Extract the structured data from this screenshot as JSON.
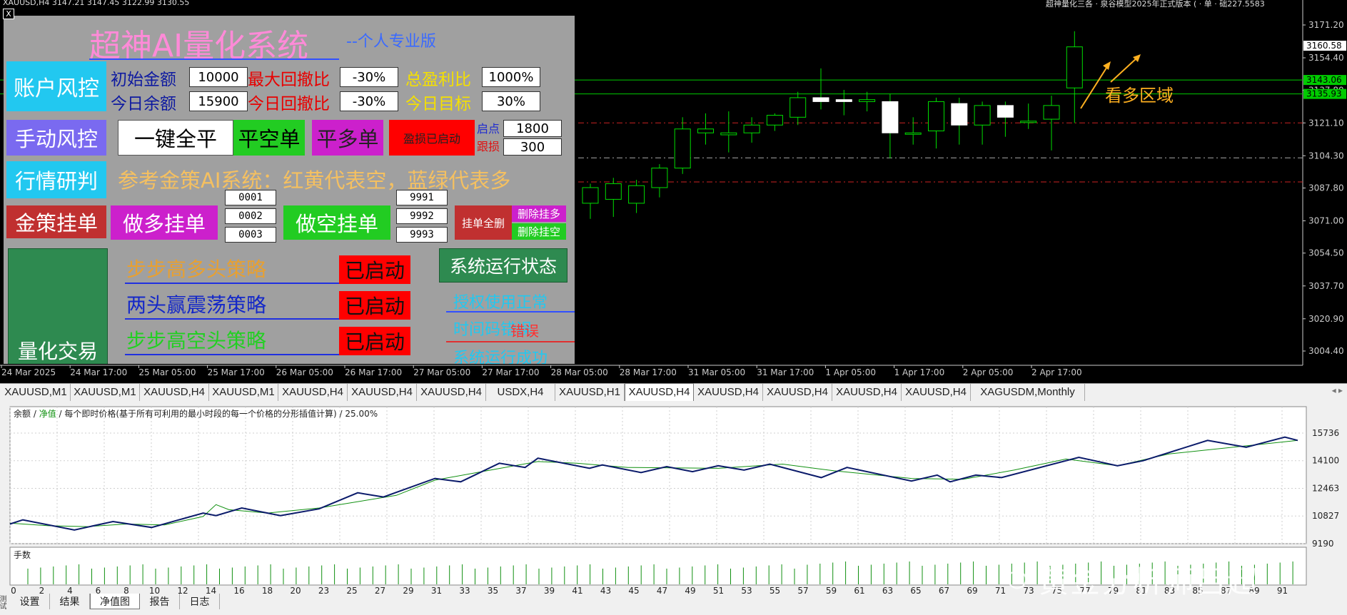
{
  "colors": {
    "bull": "#ffffff",
    "wick": "#00dd00",
    "axis": "#cccccc",
    "hline_green": "#00cc00",
    "hline_red": "#cc2222",
    "price_badge_green": "#00cc00",
    "price_badge_white": "#ffffff",
    "annot_orange": "#ffb020",
    "equity_blue": "#0a1a6a",
    "balance_green": "#109010"
  },
  "chart": {
    "header_left": "XAUUSD,H4  3147.21 3147.45 3122.99 3130.55",
    "header_right": "超神量化三各 · 泉谷模型2025年正式版本 ( · 单 · 础227.5583",
    "y_ticks": [
      "3171.20",
      "3154.40",
      "3137.80",
      "3121.10",
      "3104.30",
      "3087.80",
      "3071.00",
      "3054.50",
      "3037.70",
      "3020.90",
      "3004.40"
    ],
    "price_badges": [
      {
        "label": "3160.58",
        "price": 3160.58,
        "style": "white"
      },
      {
        "label": "3143.06",
        "price": 3143.06,
        "style": "green"
      },
      {
        "label": "3135.93",
        "price": 3135.93,
        "style": "green"
      }
    ],
    "x_ticks": [
      "24 Mar 2025",
      "24 Mar 17:00",
      "25 Mar 05:00",
      "25 Mar 17:00",
      "26 Mar 05:00",
      "26 Mar 17:00",
      "27 Mar 05:00",
      "27 Mar 17:00",
      "28 Mar 05:00",
      "28 Mar 17:00",
      "31 Mar 05:00",
      "31 Mar 17:00",
      "1 Apr 05:00",
      "1 Apr 17:00",
      "2 Apr 05:00",
      "2 Apr 17:00"
    ],
    "annotation": "看多区域",
    "candles": [
      {
        "o": 3080,
        "h": 3090,
        "l": 3072,
        "c": 3088
      },
      {
        "o": 3082,
        "h": 3093,
        "l": 3073,
        "c": 3090
      },
      {
        "o": 3080,
        "h": 3092,
        "l": 3075,
        "c": 3089
      },
      {
        "o": 3088,
        "h": 3100,
        "l": 3083,
        "c": 3098
      },
      {
        "o": 3098,
        "h": 3124,
        "l": 3095,
        "c": 3118
      },
      {
        "o": 3116,
        "h": 3126,
        "l": 3110,
        "c": 3118
      },
      {
        "o": 3115,
        "h": 3127,
        "l": 3106,
        "c": 3116
      },
      {
        "o": 3116,
        "h": 3124,
        "l": 3111,
        "c": 3120
      },
      {
        "o": 3120,
        "h": 3126,
        "l": 3117,
        "c": 3125
      },
      {
        "o": 3124,
        "h": 3137,
        "l": 3120,
        "c": 3134
      },
      {
        "o": 3134,
        "h": 3149,
        "l": 3128,
        "c": 3132
      },
      {
        "o": 3133,
        "h": 3138,
        "l": 3125,
        "c": 3132
      },
      {
        "o": 3132,
        "h": 3137,
        "l": 3127,
        "c": 3133
      },
      {
        "o": 3132,
        "h": 3136,
        "l": 3103,
        "c": 3116
      },
      {
        "o": 3116,
        "h": 3124,
        "l": 3110,
        "c": 3116
      },
      {
        "o": 3117,
        "h": 3134,
        "l": 3108,
        "c": 3132
      },
      {
        "o": 3131,
        "h": 3134,
        "l": 3110,
        "c": 3120
      },
      {
        "o": 3120,
        "h": 3132,
        "l": 3110,
        "c": 3130
      },
      {
        "o": 3130,
        "h": 3132,
        "l": 3114,
        "c": 3124
      },
      {
        "o": 3122,
        "h": 3131,
        "l": 3118,
        "c": 3122
      },
      {
        "o": 3123,
        "h": 3135,
        "l": 3107,
        "c": 3130
      },
      {
        "o": 3139,
        "h": 3168,
        "l": 3121,
        "c": 3160
      }
    ]
  },
  "panel": {
    "title": "超神AI量化系统",
    "subtitle": "--个人专业版",
    "account_btn": "账户风控",
    "manual_btn": "手动风控",
    "research_btn": "行情研判",
    "pending_btn": "金策挂单",
    "quant_btn": "量化交易",
    "init_funds_label": "初始金额",
    "init_funds_value": "10000",
    "max_dd_label": "最大回撤比",
    "max_dd_value": "-30%",
    "total_profit_label": "总盈利比",
    "total_profit_value": "1000%",
    "today_balance_label": "今日余额",
    "today_balance_value": "15900",
    "today_dd_label": "今日回撤比",
    "today_dd_value": "-30%",
    "today_target_label": "今日目标",
    "today_target_value": "30%",
    "close_all_btn": "一键全平",
    "close_short_btn": "平空单",
    "close_long_btn": "平多单",
    "trailing_btn": "盈损已启动",
    "start_label": "启点",
    "start_value": "1800",
    "trail_label": "跟损",
    "trail_value": "300",
    "reference_text": "参考金策AI系统：红黄代表空，蓝绿代表多",
    "long_order_btn": "做多挂单",
    "long_ids": [
      "0001",
      "0002",
      "0003"
    ],
    "short_order_btn": "做空挂单",
    "short_ids": [
      "9991",
      "9992",
      "9993"
    ],
    "delete_all_btn": "挂单全删",
    "delete_long_btn": "删除挂多",
    "delete_short_btn": "删除挂空",
    "strategies": [
      {
        "name": "步步高多头策略",
        "status": "已启动"
      },
      {
        "name": "两头赢震荡策略",
        "status": "已启动"
      },
      {
        "name": "步步高空头策略",
        "status": "已启动"
      }
    ],
    "system_status_btn": "系统运行状态",
    "auth_status": "授权使用正常",
    "time_code": "时间码错误",
    "time_code_overlay": "错误",
    "run_status": "系统运行成功"
  },
  "tabs": [
    {
      "label": "XAUUSD,M1"
    },
    {
      "label": "XAUUSD,M1"
    },
    {
      "label": "XAUUSD,H4"
    },
    {
      "label": "XAUUSD,M1"
    },
    {
      "label": "XAUUSD,H4"
    },
    {
      "label": "XAUUSD,H4"
    },
    {
      "label": "XAUUSD,H4"
    },
    {
      "label": "USDX,H4"
    },
    {
      "label": "XAUUSD,H1"
    },
    {
      "label": "XAUUSD,H4",
      "active": true
    },
    {
      "label": "XAUUSD,H4"
    },
    {
      "label": "XAUUSD,H4"
    },
    {
      "label": "XAUUSD,H4"
    },
    {
      "label": "XAUUSD,H4"
    },
    {
      "label": "XAGUSDM,Monthly"
    }
  ],
  "tab_arrows": "◂ ▸",
  "tester": {
    "legend_balance": "余额",
    "legend_sep": " / ",
    "legend_equity": "净值",
    "legend_desc": " / 每个即时价格(基于所有可利用的最小时段的每一个价格的分形插值计算) / 25.00%",
    "y_ticks": [
      "15736",
      "14100",
      "12463",
      "10827",
      "9190"
    ],
    "lots_label": "手数",
    "x_ticks": [
      "0",
      "2",
      "4",
      "6",
      "8",
      "10",
      "12",
      "14",
      "16",
      "18",
      "20",
      "23",
      "25",
      "27",
      "29",
      "31",
      "33",
      "35",
      "37",
      "39",
      "41",
      "43",
      "45",
      "47",
      "49",
      "51",
      "53",
      "55",
      "57",
      "59",
      "61",
      "63",
      "65",
      "67",
      "69",
      "71",
      "73",
      "75",
      "77",
      "79",
      "81",
      "83",
      "85",
      "87",
      "89",
      "91"
    ],
    "equity_data": [
      {
        "x": 0,
        "y": 10350
      },
      {
        "x": 1,
        "y": 10600
      },
      {
        "x": 5,
        "y": 10000
      },
      {
        "x": 8,
        "y": 10500
      },
      {
        "x": 11,
        "y": 10150
      },
      {
        "x": 15,
        "y": 11000
      },
      {
        "x": 16,
        "y": 10850
      },
      {
        "x": 18,
        "y": 11300
      },
      {
        "x": 21,
        "y": 10850
      },
      {
        "x": 24,
        "y": 11250
      },
      {
        "x": 27,
        "y": 12200
      },
      {
        "x": 29,
        "y": 11950
      },
      {
        "x": 33,
        "y": 13050
      },
      {
        "x": 35,
        "y": 12850
      },
      {
        "x": 38,
        "y": 13950
      },
      {
        "x": 40,
        "y": 13700
      },
      {
        "x": 41,
        "y": 14250
      },
      {
        "x": 45,
        "y": 13650
      },
      {
        "x": 46,
        "y": 13850
      },
      {
        "x": 49,
        "y": 13400
      },
      {
        "x": 51,
        "y": 13750
      },
      {
        "x": 53,
        "y": 13450
      },
      {
        "x": 55,
        "y": 13800
      },
      {
        "x": 57,
        "y": 13550
      },
      {
        "x": 59,
        "y": 13900
      },
      {
        "x": 63,
        "y": 13100
      },
      {
        "x": 65,
        "y": 13700
      },
      {
        "x": 70,
        "y": 12900
      },
      {
        "x": 72,
        "y": 13250
      },
      {
        "x": 73,
        "y": 12850
      },
      {
        "x": 75,
        "y": 13250
      },
      {
        "x": 77,
        "y": 13100
      },
      {
        "x": 83,
        "y": 14300
      },
      {
        "x": 86,
        "y": 13800
      },
      {
        "x": 88,
        "y": 14100
      },
      {
        "x": 93,
        "y": 15300
      },
      {
        "x": 96,
        "y": 14900
      },
      {
        "x": 99,
        "y": 15500
      },
      {
        "x": 100,
        "y": 15300
      }
    ],
    "balance_data": [
      {
        "x": 0,
        "y": 10400
      },
      {
        "x": 3,
        "y": 10250
      },
      {
        "x": 6,
        "y": 10200
      },
      {
        "x": 9,
        "y": 10350
      },
      {
        "x": 12,
        "y": 10300
      },
      {
        "x": 15,
        "y": 10800
      },
      {
        "x": 16,
        "y": 11500
      },
      {
        "x": 17,
        "y": 11200
      },
      {
        "x": 20,
        "y": 11000
      },
      {
        "x": 24,
        "y": 11300
      },
      {
        "x": 30,
        "y": 12050
      },
      {
        "x": 33,
        "y": 12950
      },
      {
        "x": 37,
        "y": 13500
      },
      {
        "x": 41,
        "y": 14050
      },
      {
        "x": 44,
        "y": 13950
      },
      {
        "x": 48,
        "y": 13700
      },
      {
        "x": 55,
        "y": 13650
      },
      {
        "x": 60,
        "y": 13900
      },
      {
        "x": 64,
        "y": 13500
      },
      {
        "x": 70,
        "y": 13050
      },
      {
        "x": 74,
        "y": 13000
      },
      {
        "x": 78,
        "y": 13550
      },
      {
        "x": 82,
        "y": 14200
      },
      {
        "x": 86,
        "y": 13800
      },
      {
        "x": 90,
        "y": 14500
      },
      {
        "x": 100,
        "y": 15300
      }
    ],
    "watermark": "黄金分析师吕超",
    "side_label": "测试器"
  },
  "bottom_tabs": [
    {
      "label": "设置"
    },
    {
      "label": "结果"
    },
    {
      "label": "净值图",
      "active": true
    },
    {
      "label": "报告"
    },
    {
      "label": "日志"
    }
  ]
}
